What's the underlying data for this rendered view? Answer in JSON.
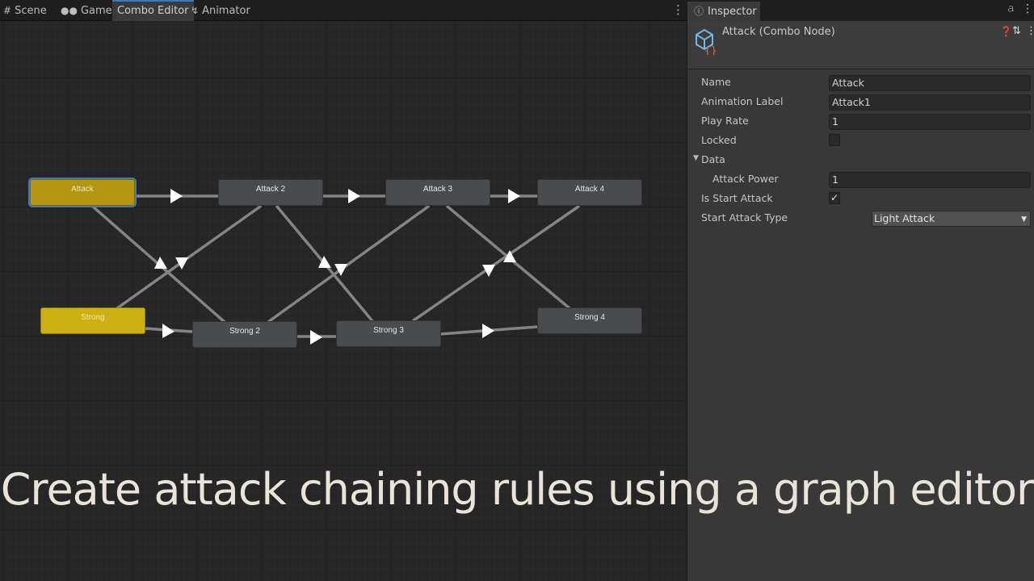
{
  "editor": {
    "tabs": [
      {
        "label": "Scene",
        "icon": "grid-icon",
        "active": false
      },
      {
        "label": "Game",
        "icon": "gamepad-icon",
        "active": false
      },
      {
        "label": "Combo Editor",
        "icon": "",
        "active": true
      },
      {
        "label": "Animator",
        "icon": "animator-icon",
        "active": false
      }
    ],
    "nodes": {
      "attack": "Attack",
      "attack2": "Attack 2",
      "attack3": "Attack 3",
      "attack4": "Attack 4",
      "strong": "Strong",
      "strong2": "Strong 2",
      "strong3": "Strong 3",
      "strong4": "Strong 4"
    },
    "colors": {
      "node_gray": "#4a4b4f",
      "node_start": "#b49612",
      "selected_outline": "#3d7bb9",
      "connection": "#8f8f8f",
      "arrow": "#ffffff"
    }
  },
  "inspector": {
    "tab_label": "Inspector",
    "title": "Attack (Combo Node)",
    "fields": {
      "name_label": "Name",
      "name_value": "Attack",
      "anim_label": "Animation Label",
      "anim_value": "Attack1",
      "playrate_label": "Play Rate",
      "playrate_value": "1",
      "locked_label": "Locked",
      "locked_checked": false,
      "data_label": "Data",
      "power_label": "Attack Power",
      "power_value": "1",
      "isstart_label": "Is Start Attack",
      "isstart_checked": true,
      "isstart_mark": "✓",
      "starttype_label": "Start Attack Type",
      "starttype_value": "Light Attack"
    }
  },
  "caption": "Create attack chaining rules using a graph editor"
}
